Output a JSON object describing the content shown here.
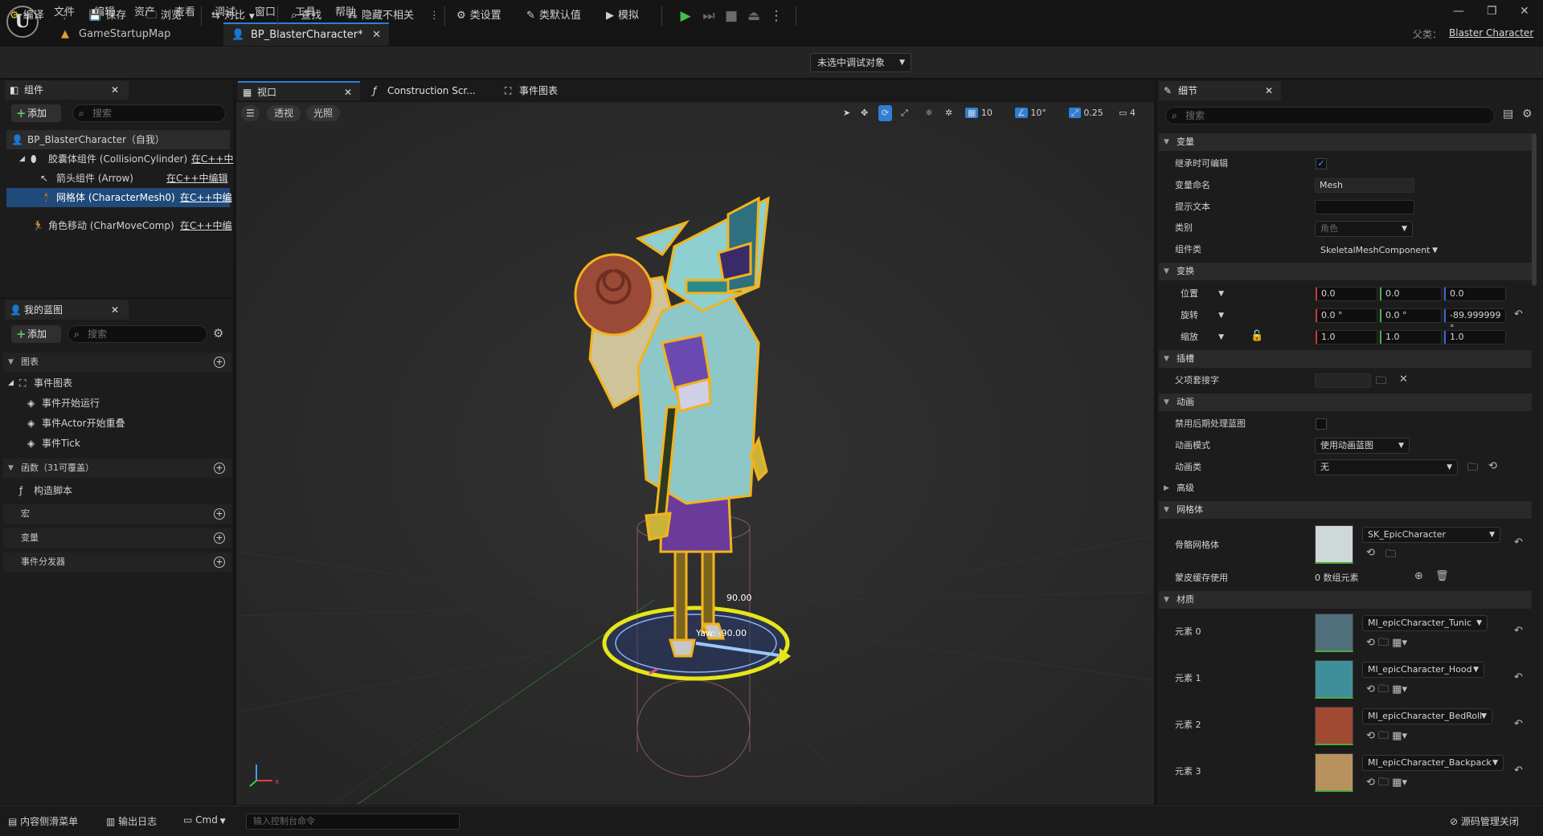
{
  "menu": [
    "文件",
    "编辑",
    "资产",
    "查看",
    "调试",
    "窗口",
    "工具",
    "帮助"
  ],
  "doc_tabs": [
    {
      "label": "GameStartupMap"
    },
    {
      "label": "BP_BlasterCharacter*"
    }
  ],
  "parent_class": {
    "label": "父类：",
    "value": "Blaster Character"
  },
  "toolbar": {
    "compile": "编译",
    "save": "保存",
    "browse": "浏览",
    "diff": "对比",
    "find": "查找",
    "hide_unrelated": "隐藏不相关",
    "class_settings": "类设置",
    "class_defaults": "类默认值",
    "simulate": "模拟",
    "debug_object": "未选中调试对象"
  },
  "components_panel": {
    "title": "组件",
    "add": "添加",
    "search_placeholder": "搜索",
    "tree": [
      {
        "label": "BP_BlasterCharacter（自我）",
        "link": ""
      },
      {
        "label": "胶囊体组件 (CollisionCylinder)",
        "link": "在C++中"
      },
      {
        "label": "箭头组件 (Arrow)",
        "link": "在C++中编辑"
      },
      {
        "label": "网格体 (CharacterMesh0)",
        "link": "在C++中编"
      },
      {
        "label": "角色移动 (CharMoveComp)",
        "link": "在C++中编"
      }
    ]
  },
  "my_blueprint": {
    "title": "我的蓝图",
    "add": "添加",
    "search_placeholder": "搜索",
    "graphs": "图表",
    "event_graph": "事件图表",
    "events": [
      "事件开始运行",
      "事件Actor开始重叠",
      "事件Tick"
    ],
    "functions": "函数（31可覆盖）",
    "construction_script": "构造脚本",
    "macros": "宏",
    "variables": "变量",
    "dispatchers": "事件分发器"
  },
  "viewport": {
    "tabs": [
      "视口",
      "Construction Scr...",
      "事件图表"
    ],
    "perspective": "透视",
    "lighting": "光照",
    "grid_size": "10",
    "rotate_snap": "10°",
    "scale_snap": "0.25",
    "camera_speed": "4",
    "gizmo_value": "90.00",
    "yaw_label": "Yaw: -90.00"
  },
  "details": {
    "title": "细节",
    "search_placeholder": "搜索",
    "sections": {
      "variable": "变量",
      "transform": "变换",
      "sockets": "插槽",
      "animation": "动画",
      "advanced": "高级",
      "mesh": "网格体",
      "materials": "材质"
    },
    "editable_inherited": "继承时可编辑",
    "var_name_label": "变量命名",
    "var_name": "Mesh",
    "tooltip_label": "提示文本",
    "tooltip": "",
    "category_label": "类别",
    "category": "角色",
    "component_class_label": "组件类",
    "component_class": "SkeletalMeshComponent",
    "location": {
      "label": "位置",
      "x": "0.0",
      "y": "0.0",
      "z": "0.0"
    },
    "rotation": {
      "label": "旋转",
      "x": "0.0 °",
      "y": "0.0 °",
      "z": "-89.999999 °"
    },
    "scale": {
      "label": "缩放",
      "x": "1.0",
      "y": "1.0",
      "z": "1.0"
    },
    "parent_socket_label": "父项套接字",
    "disable_post_process_label": "禁用后期处理蓝图",
    "anim_mode_label": "动画模式",
    "anim_mode": "使用动画蓝图",
    "anim_class_label": "动画类",
    "anim_class": "无",
    "skeletal_mesh_label": "骨骼网格体",
    "skeletal_mesh": "SK_EpicCharacter",
    "skin_cache_label": "蒙皮缓存使用",
    "skin_cache": "0 数组元素",
    "materials": [
      {
        "label": "元素 0",
        "value": "MI_epicCharacter_Tunic",
        "color": "#4f6f7a"
      },
      {
        "label": "元素 1",
        "value": "MI_epicCharacter_Hood",
        "color": "#3f8f9a"
      },
      {
        "label": "元素 2",
        "value": "MI_epicCharacter_BedRoll",
        "color": "#a04a34"
      },
      {
        "label": "元素 3",
        "value": "MI_epicCharacter_Backpack",
        "color": "#b8925e"
      }
    ]
  },
  "statusbar": {
    "content_drawer": "内容侧滑菜单",
    "output_log": "输出日志",
    "cmd": "Cmd",
    "console_placeholder": "输入控制台命令",
    "source_control": "源码管理关闭"
  },
  "colors": {
    "accent": "#2f7fd6",
    "play": "#45c045",
    "outline": "#f2b31c"
  }
}
